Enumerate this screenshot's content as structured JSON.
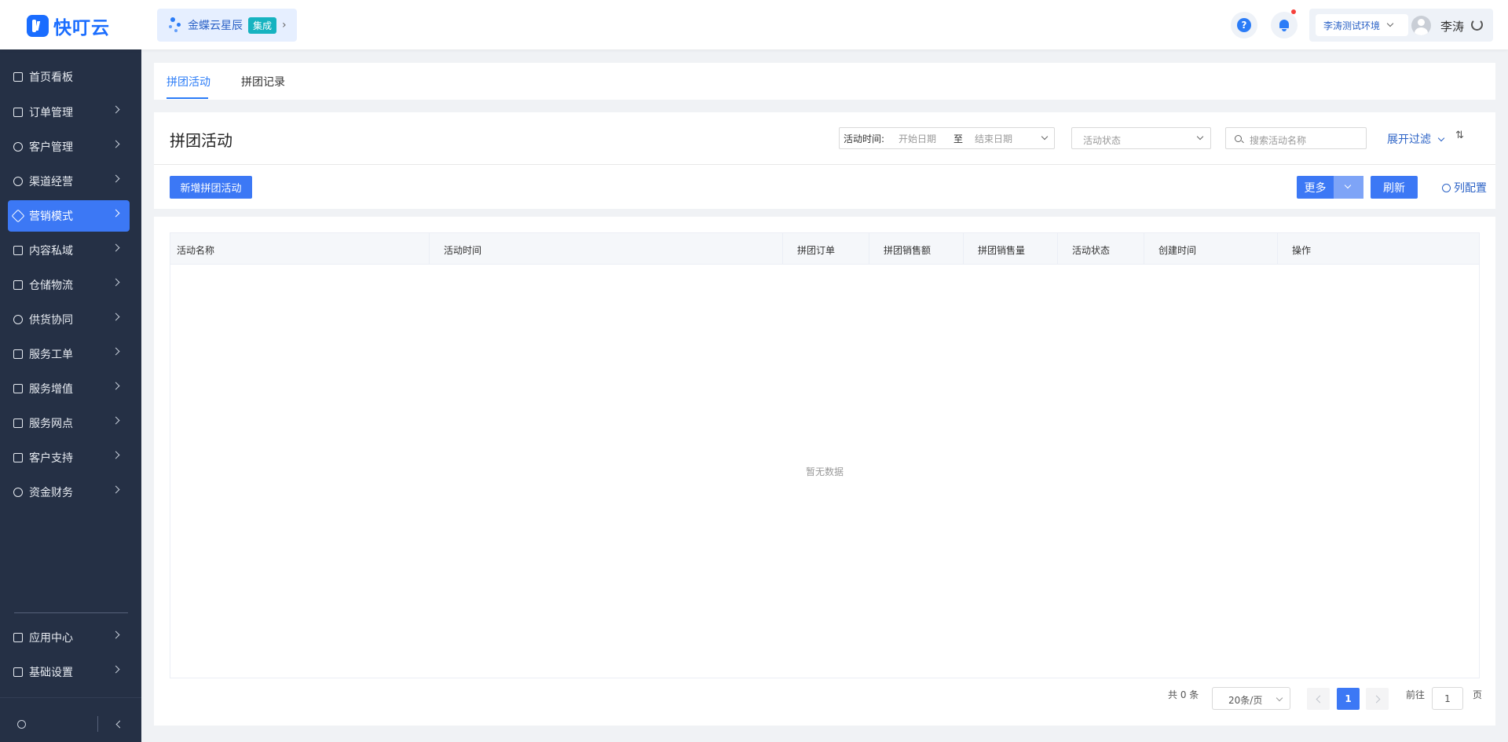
{
  "app": {
    "logo_text": "快叮云",
    "brand_color": "#1a6dff",
    "accent_color": "#3c78f5"
  },
  "header": {
    "tenant_name": "金蝶云星辰",
    "tenant_badge": "集成",
    "env_label": "李涛测试环境",
    "user_name": "李涛",
    "help_label": "?"
  },
  "sidebar": {
    "items": [
      {
        "label": "首页看板",
        "icon": "home-icon"
      },
      {
        "label": "订单管理",
        "icon": "clipboard-icon"
      },
      {
        "label": "客户管理",
        "icon": "user-icon"
      },
      {
        "label": "渠道经营",
        "icon": "network-icon"
      },
      {
        "label": "营销模式",
        "icon": "tag-icon"
      },
      {
        "label": "内容私域",
        "icon": "image-icon"
      },
      {
        "label": "仓储物流",
        "icon": "box-icon"
      },
      {
        "label": "供货协同",
        "icon": "supplier-icon"
      },
      {
        "label": "服务工单",
        "icon": "ticket-icon"
      },
      {
        "label": "服务增值",
        "icon": "bag-icon"
      },
      {
        "label": "服务网点",
        "icon": "store-icon"
      },
      {
        "label": "客户支持",
        "icon": "support-icon"
      },
      {
        "label": "资金财务",
        "icon": "yen-icon"
      }
    ],
    "bottom_items": [
      {
        "label": "应用中心",
        "icon": "cube-icon"
      },
      {
        "label": "基础设置",
        "icon": "settings-icon"
      }
    ]
  },
  "tabs": [
    {
      "label": "拼团活动"
    },
    {
      "label": "拼团记录"
    }
  ],
  "page": {
    "title": "拼团活动",
    "filters": {
      "date_label": "活动时间:",
      "start_placeholder": "开始日期",
      "range_sep": "至",
      "end_placeholder": "结束日期",
      "status_placeholder": "活动状态",
      "search_placeholder": "搜索活动名称",
      "expand_label": "展开过滤"
    },
    "toolbar": {
      "add_label": "新增拼团活动",
      "more_label": "更多",
      "refresh_label": "刷新",
      "column_config_label": "列配置"
    }
  },
  "table": {
    "columns": [
      "活动名称",
      "活动时间",
      "拼团订单",
      "拼团销售额",
      "拼团销售量",
      "活动状态",
      "创建时间",
      "操作"
    ],
    "rows": [],
    "empty_text": "暂无数据"
  },
  "pagination": {
    "total_text": "共 0 条",
    "page_size": "20条/页",
    "current_page": "1",
    "goto_label": "前往",
    "goto_value": "1",
    "page_unit": "页"
  }
}
